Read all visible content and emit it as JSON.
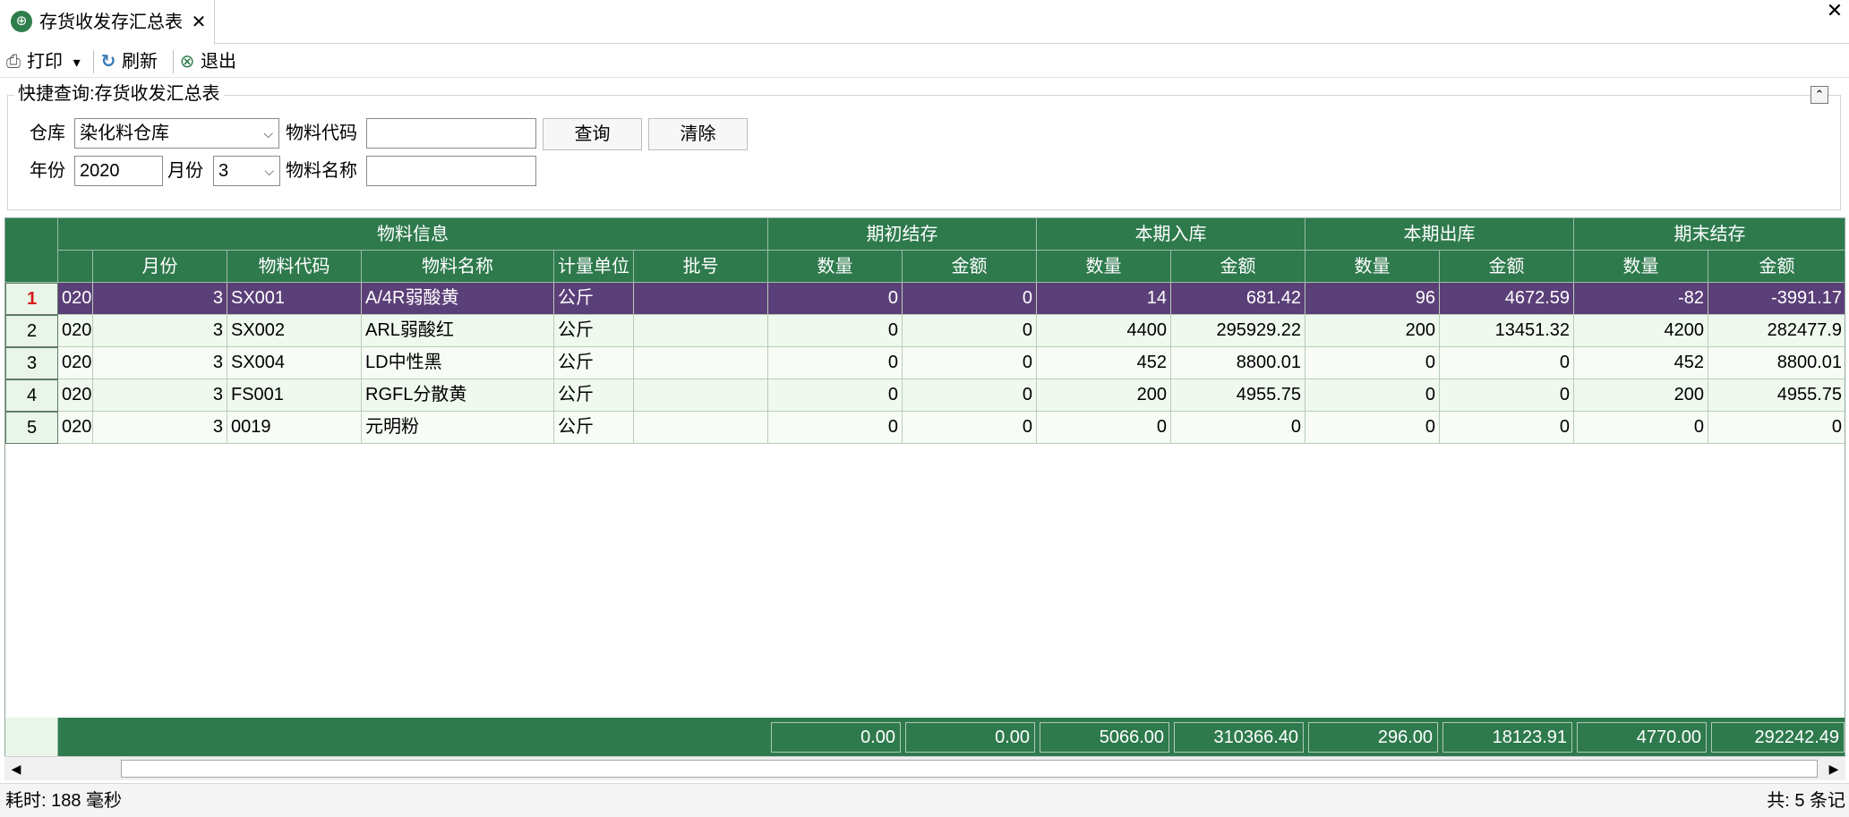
{
  "tab": {
    "title": "存货收发存汇总表",
    "close": "✕",
    "icon": "globe-icon"
  },
  "window": {
    "close": "✕"
  },
  "toolbar": {
    "print": "打印",
    "print_dropdown": "▾",
    "refresh": "刷新",
    "exit": "退出"
  },
  "query": {
    "group_title": "快捷查询:存货收发汇总表",
    "collapse": "⌃",
    "warehouse_label": "仓库",
    "warehouse_value": "染化料仓库",
    "item_code_label": "物料代码",
    "item_code_value": "",
    "search_button": "查询",
    "clear_button": "清除",
    "year_label": "年份",
    "year_value": "2020",
    "month_label": "月份",
    "month_value": "3",
    "item_name_label": "物料名称",
    "item_name_value": ""
  },
  "grid": {
    "group_headers": [
      "物料信息",
      "期初结存",
      "本期入库",
      "本期出库",
      "期末结存"
    ],
    "columns": [
      "",
      "月份",
      "物料代码",
      "物料名称",
      "计量单位",
      "批号",
      "数量",
      "金额",
      "数量",
      "金额",
      "数量",
      "金额",
      "数量",
      "金额"
    ],
    "rows": [
      {
        "num": "1",
        "cells": [
          "020",
          "3",
          "SX001",
          "A/4R弱酸黄",
          "公斤",
          "",
          "0",
          "0",
          "14",
          "681.42",
          "96",
          "4672.59",
          "-82",
          "-3991.17"
        ]
      },
      {
        "num": "2",
        "cells": [
          "020",
          "3",
          "SX002",
          "ARL弱酸红",
          "公斤",
          "",
          "0",
          "0",
          "4400",
          "295929.22",
          "200",
          "13451.32",
          "4200",
          "282477.9"
        ]
      },
      {
        "num": "3",
        "cells": [
          "020",
          "3",
          "SX004",
          "LD中性黑",
          "公斤",
          "",
          "0",
          "0",
          "452",
          "8800.01",
          "0",
          "0",
          "452",
          "8800.01"
        ]
      },
      {
        "num": "4",
        "cells": [
          "020",
          "3",
          "FS001",
          "RGFL分散黄",
          "公斤",
          "",
          "0",
          "0",
          "200",
          "4955.75",
          "0",
          "0",
          "200",
          "4955.75"
        ]
      },
      {
        "num": "5",
        "cells": [
          "020",
          "3",
          "0019",
          "元明粉",
          "公斤",
          "",
          "0",
          "0",
          "0",
          "0",
          "0",
          "0",
          "0",
          "0"
        ]
      }
    ],
    "selected_row": 0,
    "footer": [
      "0.00",
      "0.00",
      "5066.00",
      "310366.40",
      "296.00",
      "18123.91",
      "4770.00",
      "292242.49"
    ]
  },
  "scroll": {
    "left": "◀",
    "right": "▶"
  },
  "status": {
    "elapsed": "耗时: 188 毫秒",
    "count": "共: 5 条记"
  },
  "colors": {
    "header_green": "#2e7a4d",
    "selected_purple": "#5b3f78",
    "row_tint": "#eff9ee"
  }
}
